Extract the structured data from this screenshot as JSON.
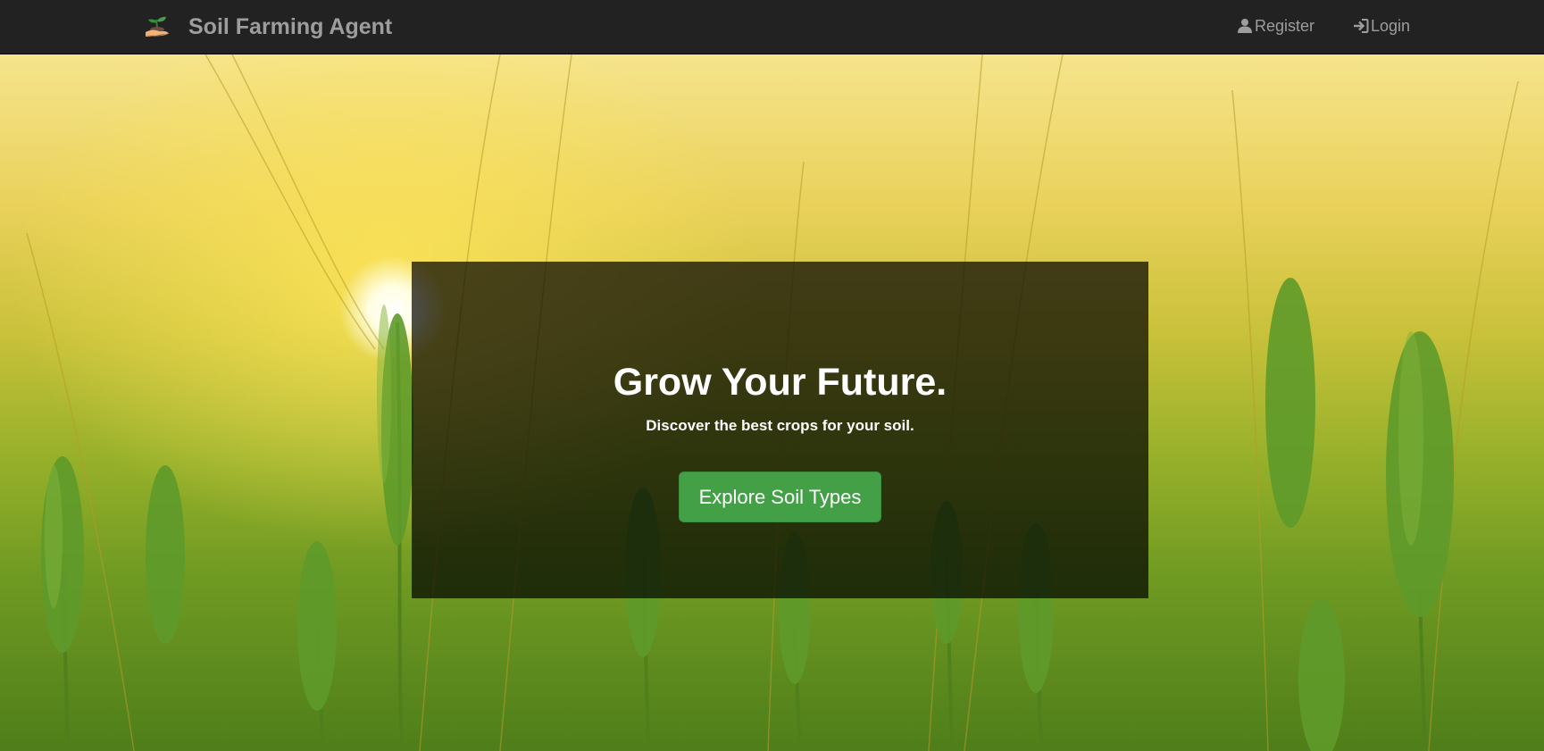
{
  "navbar": {
    "brand_name": "Soil Farming Agent",
    "brand_icon": "sprout-in-hand-icon",
    "register_label": "Register",
    "register_icon": "user-icon",
    "login_label": "Login",
    "login_icon": "sign-in-icon"
  },
  "hero": {
    "background": "wheat-field-sunset-image",
    "title": "Grow Your Future.",
    "subtitle": "Discover the best crops for your soil.",
    "button_label": "Explore Soil Types"
  },
  "colors": {
    "navbar_bg": "#222222",
    "nav_text": "#9d9d9d",
    "button_green": "#43a047",
    "overlay": "rgba(0,0,0,0.7)",
    "text_white": "#ffffff"
  }
}
